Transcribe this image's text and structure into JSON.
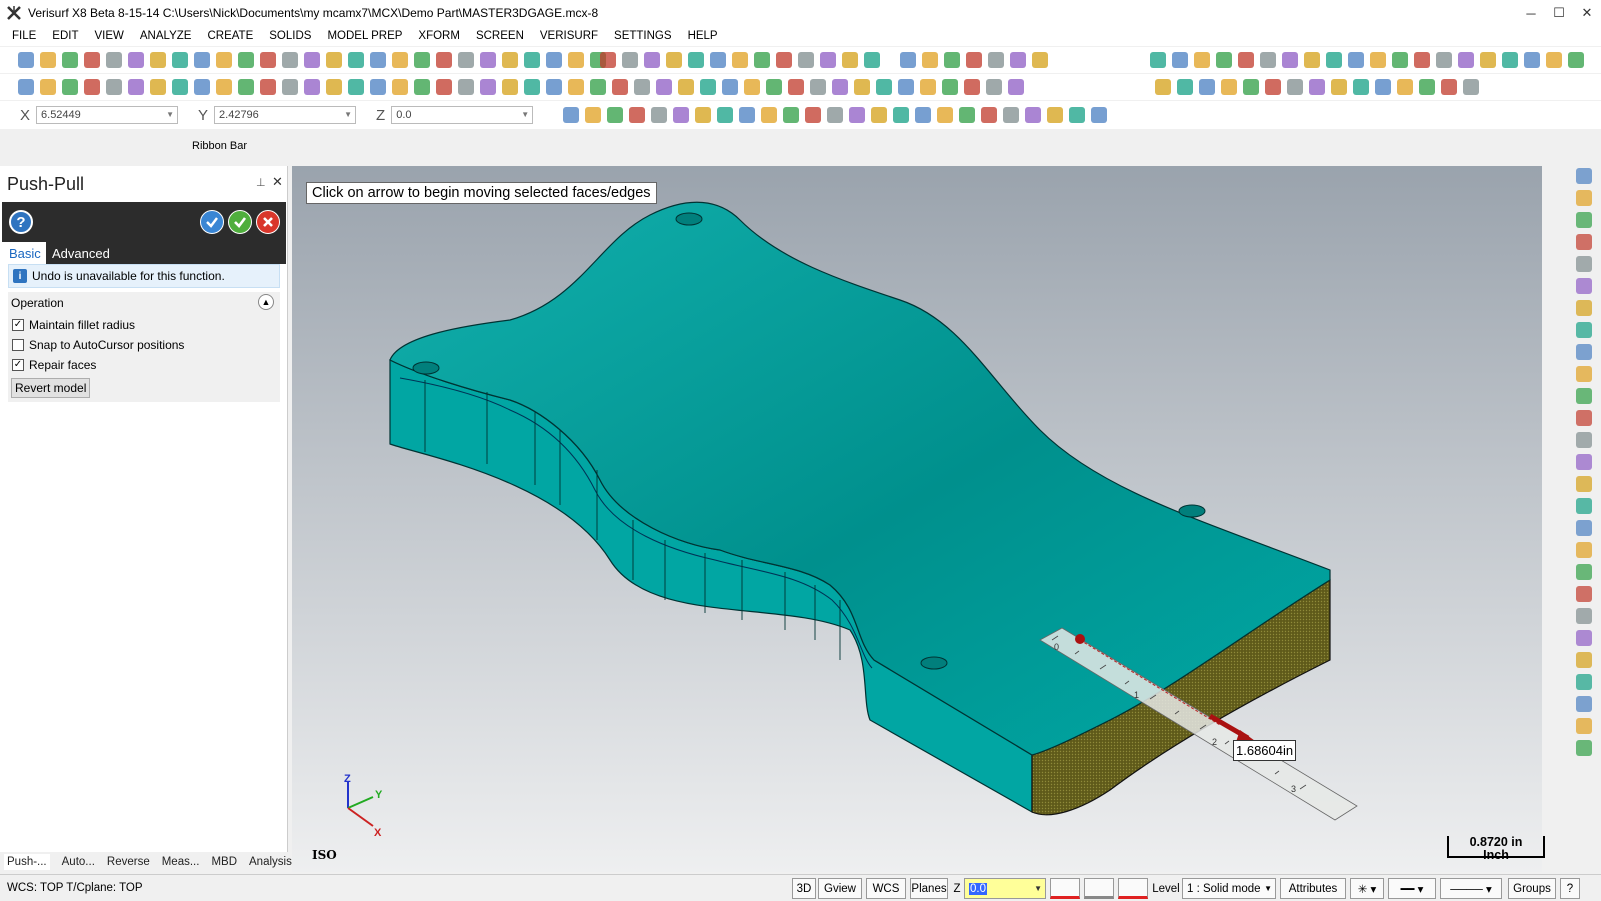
{
  "window": {
    "title": "Verisurf X8 Beta 8-15-14 C:\\Users\\Nick\\Documents\\my mcamx7\\MCX\\Demo Part\\MASTER3DGAGE.mcx-8",
    "minimize": "─",
    "maximize": "☐",
    "close": "✕"
  },
  "menu": [
    "FILE",
    "EDIT",
    "VIEW",
    "ANALYZE",
    "CREATE",
    "SOLIDS",
    "MODEL PREP",
    "XFORM",
    "SCREEN",
    "VERISURF",
    "SETTINGS",
    "HELP"
  ],
  "coords": {
    "x_label": "X",
    "x_value": "6.52449",
    "y_label": "Y",
    "y_value": "2.42796",
    "z_label": "Z",
    "z_value": "0.0"
  },
  "ribbon_bar_label": "Ribbon Bar",
  "panel": {
    "title": "Push-Pull",
    "pin": "⊥",
    "close": "✕",
    "help": "?",
    "tabs": {
      "basic": "Basic",
      "advanced": "Advanced"
    },
    "info": "Undo is unavailable for this function.",
    "operation_header": "Operation",
    "options": [
      {
        "label": "Maintain fillet radius",
        "checked": true
      },
      {
        "label": "Snap to AutoCursor positions",
        "checked": false
      },
      {
        "label": "Repair faces",
        "checked": true
      }
    ],
    "revert_label": "Revert model"
  },
  "bottom_tabs": [
    "Push-...",
    "Auto...",
    "Reverse",
    "Meas...",
    "MBD",
    "Analysis"
  ],
  "viewport": {
    "tooltip": "Click on arrow to begin moving selected faces/edges",
    "dimension": "1.68604in",
    "view_label": "ISO",
    "scale_value": "0.8720 in",
    "scale_unit": "Inch",
    "axis_x": "X",
    "axis_y": "Y",
    "axis_z": "Z",
    "ruler_ticks": [
      "0",
      "1",
      "2",
      "3"
    ],
    "model_color": "#009e9c"
  },
  "status": {
    "text": "WCS: TOP  T/Cplane: TOP",
    "view3d": "3D",
    "gview": "Gview",
    "wcs": "WCS",
    "planes": "Planes",
    "z_label": "Z",
    "z_value": "0.0",
    "level_label": "Level",
    "level_value": "1 : Solid mode",
    "attributes": "Attributes",
    "groups": "Groups",
    "help": "?"
  }
}
